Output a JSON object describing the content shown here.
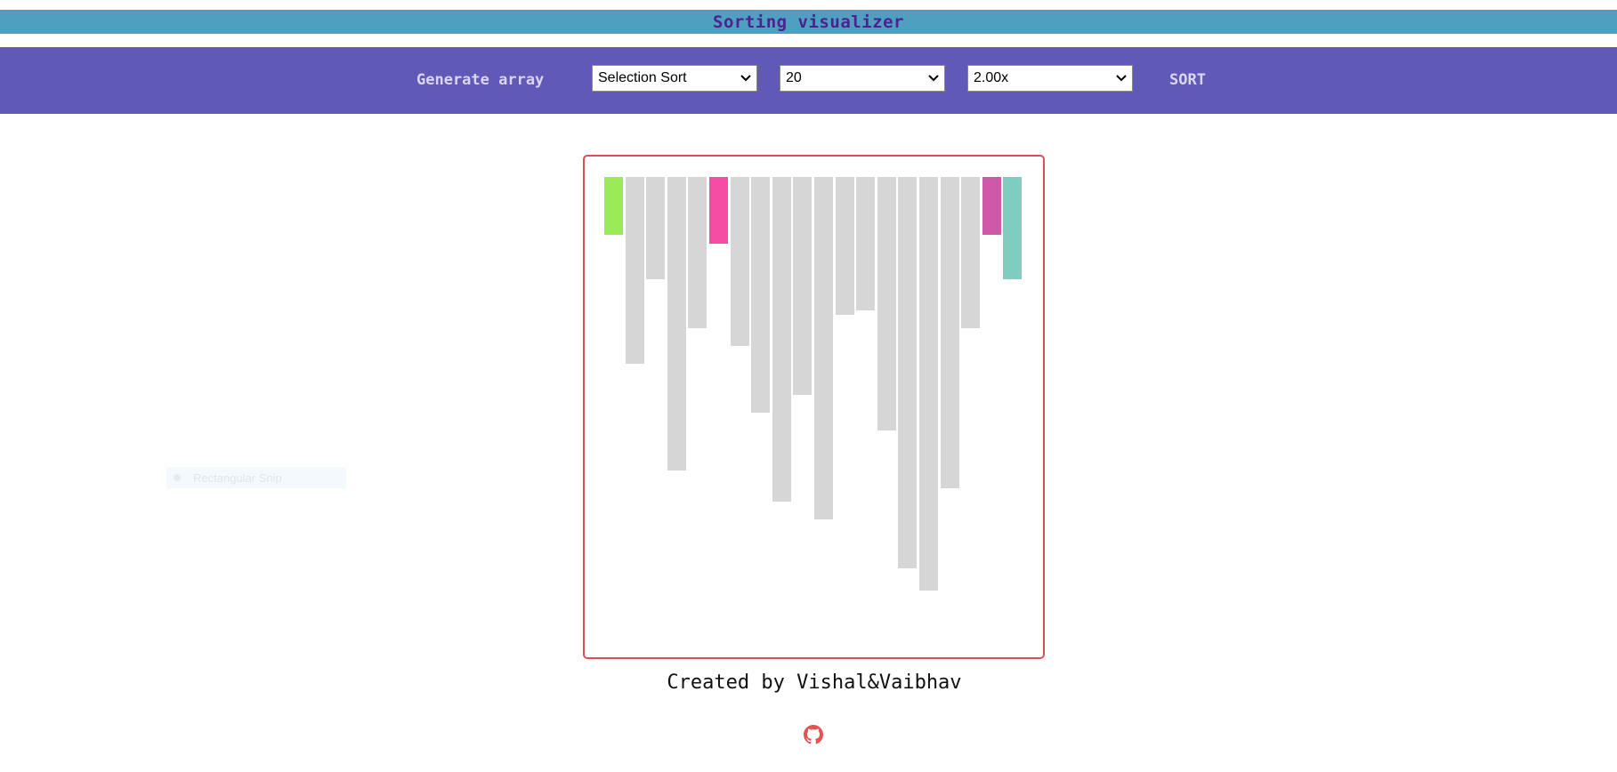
{
  "app": {
    "title": "Sorting visualizer"
  },
  "toolbar": {
    "generate_label": "Generate array",
    "algorithm": {
      "selected": "Selection Sort"
    },
    "size": {
      "selected": "20"
    },
    "speed": {
      "selected": "2.00x"
    },
    "sort_label": "SORT"
  },
  "array": {
    "values": [
      65,
      210,
      115,
      330,
      170,
      75,
      190,
      265,
      365,
      245,
      385,
      155,
      150,
      285,
      440,
      465,
      350,
      170,
      65,
      115
    ],
    "max": 540,
    "states": [
      "sorted",
      "default",
      "default",
      "default",
      "default",
      "compare",
      "default",
      "default",
      "default",
      "default",
      "default",
      "default",
      "default",
      "default",
      "default",
      "default",
      "default",
      "default",
      "current",
      "minimum"
    ],
    "colors": {
      "default": "#d6d6d6",
      "sorted": "#9bea58",
      "compare": "#f54ca4",
      "current": "#d058a8",
      "minimum": "#7fcdbf"
    }
  },
  "background_overlay": {
    "label": "Rectangular Snip"
  },
  "footer": {
    "credit": "Created by Vishal&Vaibhav",
    "github_icon": "github-icon",
    "github_color": "#e8524f"
  }
}
